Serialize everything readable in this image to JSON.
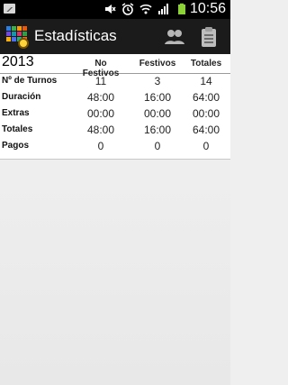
{
  "status_bar": {
    "time": "10:56",
    "icons": [
      "gallery-icon",
      "mute-icon",
      "alarm-icon",
      "wifi-icon",
      "signal-icon",
      "battery-icon"
    ]
  },
  "action_bar": {
    "title": "Estadísticas",
    "icons": [
      "app-logo-icon",
      "people-icon",
      "clipboard-icon"
    ]
  },
  "table": {
    "year": "2013",
    "columns": [
      "No Festivos",
      "Festivos",
      "Totales"
    ],
    "rows": [
      {
        "label": "Nº de Turnos",
        "values": [
          "11",
          "3",
          "14"
        ]
      },
      {
        "label": "Duración",
        "values": [
          "48:00",
          "16:00",
          "64:00"
        ]
      },
      {
        "label": "Extras",
        "values": [
          "00:00",
          "00:00",
          "00:00"
        ]
      },
      {
        "label": "Totales",
        "values": [
          "48:00",
          "16:00",
          "64:00"
        ]
      },
      {
        "label": "Pagos",
        "values": [
          "0",
          "0",
          "0"
        ]
      }
    ]
  }
}
